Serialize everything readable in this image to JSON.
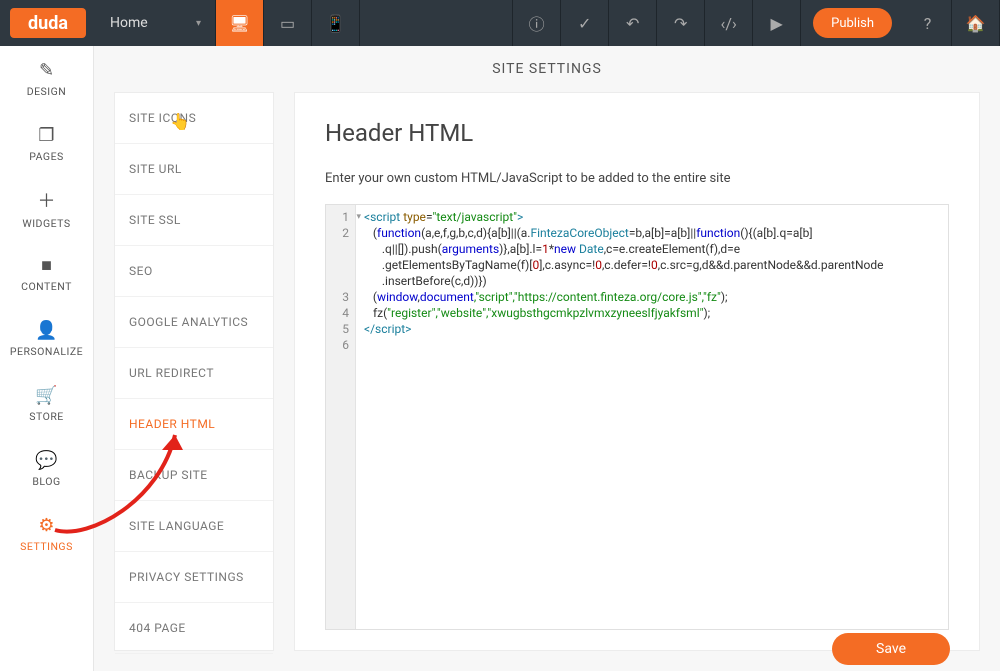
{
  "topbar": {
    "logo": "duda",
    "page_selector": "Home",
    "publish": "Publish"
  },
  "leftbar": [
    {
      "icon": "✎",
      "label": "DESIGN"
    },
    {
      "icon": "❐",
      "label": "PAGES"
    },
    {
      "icon": "＋",
      "label": "WIDGETS"
    },
    {
      "icon": "■",
      "label": "CONTENT"
    },
    {
      "icon": "👤",
      "label": "PERSONALIZE"
    },
    {
      "icon": "🛒",
      "label": "STORE"
    },
    {
      "icon": "💬",
      "label": "BLOG"
    },
    {
      "icon": "⚙",
      "label": "SETTINGS"
    }
  ],
  "section_title": "SITE SETTINGS",
  "settings_list": [
    "SITE ICONS",
    "SITE URL",
    "SITE SSL",
    "SEO",
    "GOOGLE ANALYTICS",
    "URL REDIRECT",
    "HEADER HTML",
    "BACKUP SITE",
    "SITE LANGUAGE",
    "PRIVACY SETTINGS",
    "404 PAGE"
  ],
  "settings_active_index": 6,
  "main": {
    "title": "Header HTML",
    "description": "Enter your own custom HTML/JavaScript to be added to the entire site",
    "save": "Save"
  },
  "code": {
    "lines": [
      "1",
      "2",
      "3",
      "4",
      "5",
      "6"
    ],
    "fz_register_args": "\"register\",\"website\",\"xwugbsthgcmkpzlvmxzyneeslfjyakfsml\"",
    "core_js_args": ",\"script\",\"https://content.finteza.org/core.js\",\"fz\""
  }
}
